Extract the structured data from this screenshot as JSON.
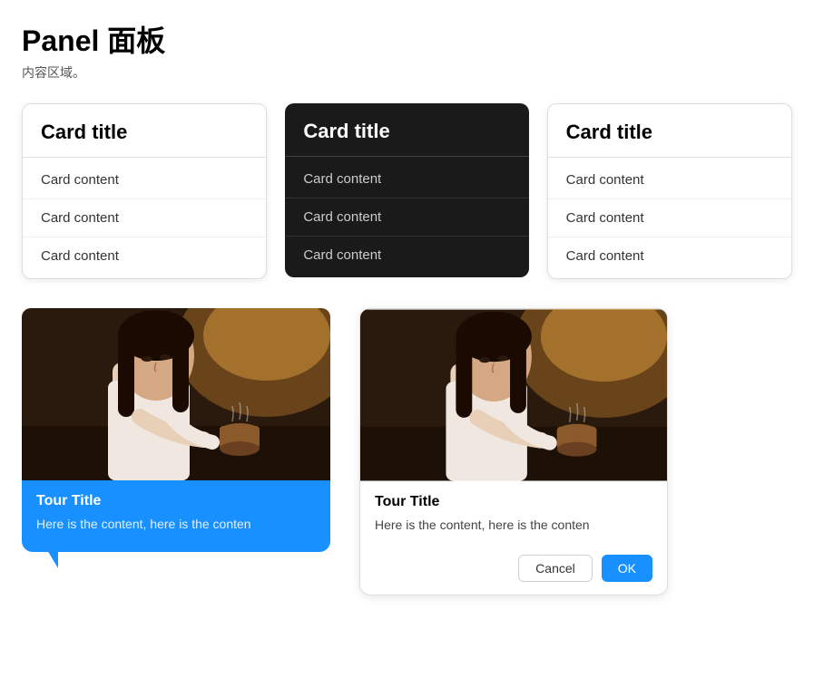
{
  "page": {
    "title": "Panel 面板",
    "subtitle": "内容区域。"
  },
  "cards": [
    {
      "id": "card-light",
      "theme": "light",
      "title": "Card title",
      "items": [
        "Card content",
        "Card content",
        "Card content"
      ]
    },
    {
      "id": "card-dark",
      "theme": "dark",
      "title": "Card title",
      "items": [
        "Card content",
        "Card content",
        "Card content"
      ]
    },
    {
      "id": "card-right",
      "theme": "right",
      "title": "Card title",
      "items": [
        "Card content",
        "Card content",
        "Card content"
      ]
    }
  ],
  "tour_cards": [
    {
      "id": "tour-blue",
      "theme": "blue",
      "title": "Tour Title",
      "text": "Here is the content, here is the conten",
      "has_actions": false
    },
    {
      "id": "tour-normal",
      "theme": "normal",
      "title": "Tour Title",
      "text": "Here is the content, here is the conten",
      "has_actions": true,
      "cancel_label": "Cancel",
      "ok_label": "OK"
    }
  ],
  "colors": {
    "blue": "#1890ff",
    "dark": "#1a1a1a"
  }
}
